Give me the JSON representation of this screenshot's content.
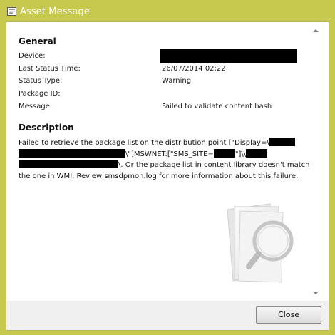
{
  "window": {
    "title": "Asset Message"
  },
  "general": {
    "heading": "General",
    "fields": [
      {
        "label": "Device:",
        "value": ""
      },
      {
        "label": "Last Status Time:",
        "value": "26/07/2014 02:22"
      },
      {
        "label": "Status Type:",
        "value": "Warning"
      },
      {
        "label": "Package ID:",
        "value": ""
      },
      {
        "label": "Message:",
        "value": "Failed to validate content hash"
      }
    ]
  },
  "description": {
    "heading": "Description",
    "part1": "Failed to retrieve the package list on the distribution point [\"Display=\\",
    "part2": "\\\"]MSWNET:[\"SMS_SITE=",
    "part3": "\"]\\\\",
    "part4": "\\. Or the package list in content library doesn't match the one in WMI. Review smsdpmon.log for more information about this failure."
  },
  "footer": {
    "close_label": "Close"
  },
  "colors": {
    "frame": "#c7c84e",
    "content_bg": "#ffffff",
    "footer_bg": "#f0f0f0"
  },
  "icons": {
    "title": "asset-message-icon",
    "emblem": "magnifier-document-icon"
  }
}
